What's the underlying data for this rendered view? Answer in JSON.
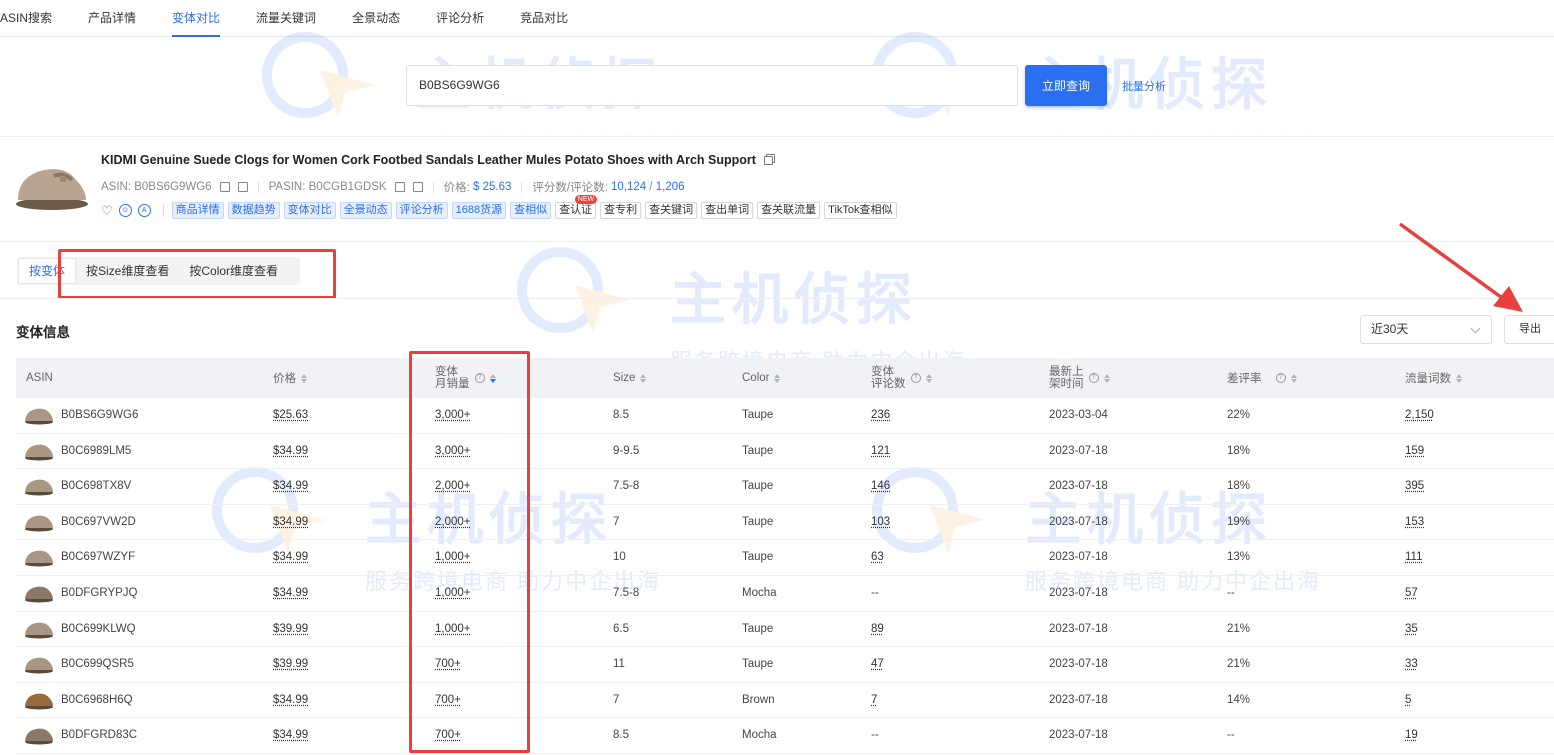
{
  "nav": {
    "tabs": [
      {
        "label": "ASIN搜索"
      },
      {
        "label": "产品详情"
      },
      {
        "label": "变体对比"
      },
      {
        "label": "流量关键词"
      },
      {
        "label": "全景动态"
      },
      {
        "label": "评论分析"
      },
      {
        "label": "竞品对比"
      }
    ],
    "active": "变体对比"
  },
  "search": {
    "value": "B0BS6G9WG6",
    "button_label": "立即查询",
    "batch_label": "批量分析"
  },
  "product": {
    "title": "KIDMI Genuine Suede Clogs for Women Cork Footbed Sandals Leather Mules Potato Shoes with Arch Support",
    "asin_label": "ASIN: B0BS6G9WG6",
    "pasin_label": "PASIN: B0CGB1GDSK",
    "price_label": "价格:",
    "price_value": "$ 25.63",
    "rating_label": "评分数/评论数:",
    "rating_value": "10,124",
    "rating_sep": "/",
    "review_value": "1,206",
    "tags_blue": [
      "商品详情",
      "数据趋势",
      "变体对比",
      "全景动态",
      "评论分析",
      "1688货源",
      "查相似"
    ],
    "tags_gray": [
      "查认证",
      "查专利",
      "查关键词",
      "查出单词",
      "查关联流量",
      "TikTok查相似"
    ],
    "new_badge": "NEW"
  },
  "view_tabs": {
    "items": [
      {
        "label": "按变体"
      },
      {
        "label": "按Size维度查看"
      },
      {
        "label": "按Color维度查看"
      }
    ]
  },
  "section": {
    "title": "变体信息",
    "range": "近30天",
    "export_label": "导出"
  },
  "table": {
    "headers": {
      "asin": "ASIN",
      "price": "价格",
      "sales_1": "变体",
      "sales_2": "月销量",
      "size": "Size",
      "color": "Color",
      "reviews_1": "变体",
      "reviews_2": "评论数",
      "listed_1": "最新上",
      "listed_2": "架时间",
      "bad_rate": "差评率",
      "keywords": "流量词数"
    },
    "rows": [
      {
        "asin": "B0BS6G9WG6",
        "price": "$25.63",
        "sales": "3,000+",
        "size": "8.5",
        "color": "Taupe",
        "reviews": "236",
        "date": "2023-03-04",
        "bad": "22%",
        "kw": "2,150",
        "shoe": "taupe"
      },
      {
        "asin": "B0C6989LM5",
        "price": "$34.99",
        "sales": "3,000+",
        "size": "9-9.5",
        "color": "Taupe",
        "reviews": "121",
        "date": "2023-07-18",
        "bad": "18%",
        "kw": "159",
        "shoe": "taupe"
      },
      {
        "asin": "B0C698TX8V",
        "price": "$34.99",
        "sales": "2,000+",
        "size": "7.5-8",
        "color": "Taupe",
        "reviews": "146",
        "date": "2023-07-18",
        "bad": "18%",
        "kw": "395",
        "shoe": "taupe"
      },
      {
        "asin": "B0C697VW2D",
        "price": "$34.99",
        "sales": "2,000+",
        "size": "7",
        "color": "Taupe",
        "reviews": "103",
        "date": "2023-07-18",
        "bad": "19%",
        "kw": "153",
        "shoe": "taupe"
      },
      {
        "asin": "B0C697WZYF",
        "price": "$34.99",
        "sales": "1,000+",
        "size": "10",
        "color": "Taupe",
        "reviews": "63",
        "date": "2023-07-18",
        "bad": "13%",
        "kw": "111",
        "shoe": "taupe"
      },
      {
        "asin": "B0DFGRYPJQ",
        "price": "$34.99",
        "sales": "1,000+",
        "size": "7.5-8",
        "color": "Mocha",
        "reviews": "--",
        "date": "2023-07-18",
        "bad": "--",
        "kw": "57",
        "shoe": "mocha"
      },
      {
        "asin": "B0C699KLWQ",
        "price": "$39.99",
        "sales": "1,000+",
        "size": "6.5",
        "color": "Taupe",
        "reviews": "89",
        "date": "2023-07-18",
        "bad": "21%",
        "kw": "35",
        "shoe": "taupe"
      },
      {
        "asin": "B0C699QSR5",
        "price": "$39.99",
        "sales": "700+",
        "size": "11",
        "color": "Taupe",
        "reviews": "47",
        "date": "2023-07-18",
        "bad": "21%",
        "kw": "33",
        "shoe": "taupe"
      },
      {
        "asin": "B0C6968H6Q",
        "price": "$34.99",
        "sales": "700+",
        "size": "7",
        "color": "Brown",
        "reviews": "7",
        "date": "2023-07-18",
        "bad": "14%",
        "kw": "5",
        "shoe": "brown"
      },
      {
        "asin": "B0DFGRD83C",
        "price": "$34.99",
        "sales": "700+",
        "size": "8.5",
        "color": "Mocha",
        "reviews": "--",
        "date": "2023-07-18",
        "bad": "--",
        "kw": "19",
        "shoe": "mocha"
      }
    ]
  },
  "watermark": {
    "logo": "主机侦探",
    "slogan": "服务跨境电商 助力中企出海"
  },
  "colors": {
    "accent": "#2a6ff0",
    "highlight_box": "#e8403c",
    "shoe_taupe": "#a99683",
    "shoe_mocha": "#8a7868",
    "shoe_brown": "#9a6a3c"
  }
}
